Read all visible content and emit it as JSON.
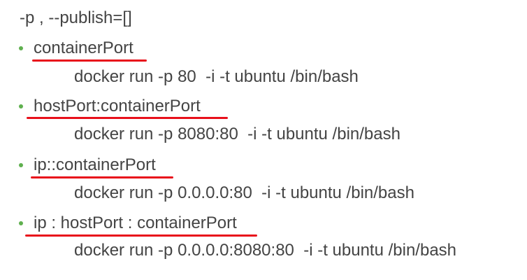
{
  "title": "-p , --publish=[]",
  "colors": {
    "text": "#444444",
    "bullet": "#5fb04f",
    "underline": "#e8101b"
  },
  "items": [
    {
      "term": "containerPort",
      "command": "docker run -p 80  -i -t ubuntu /bin/bash"
    },
    {
      "term": "hostPort:containerPort",
      "command": "docker run -p 8080:80  -i -t ubuntu /bin/bash"
    },
    {
      "term": "ip::containerPort",
      "command": "docker run -p 0.0.0.0:80  -i -t ubuntu /bin/bash"
    },
    {
      "term": "ip : hostPort : containerPort",
      "command": "docker run -p 0.0.0.0:8080:80  -i -t ubuntu /bin/bash"
    }
  ]
}
